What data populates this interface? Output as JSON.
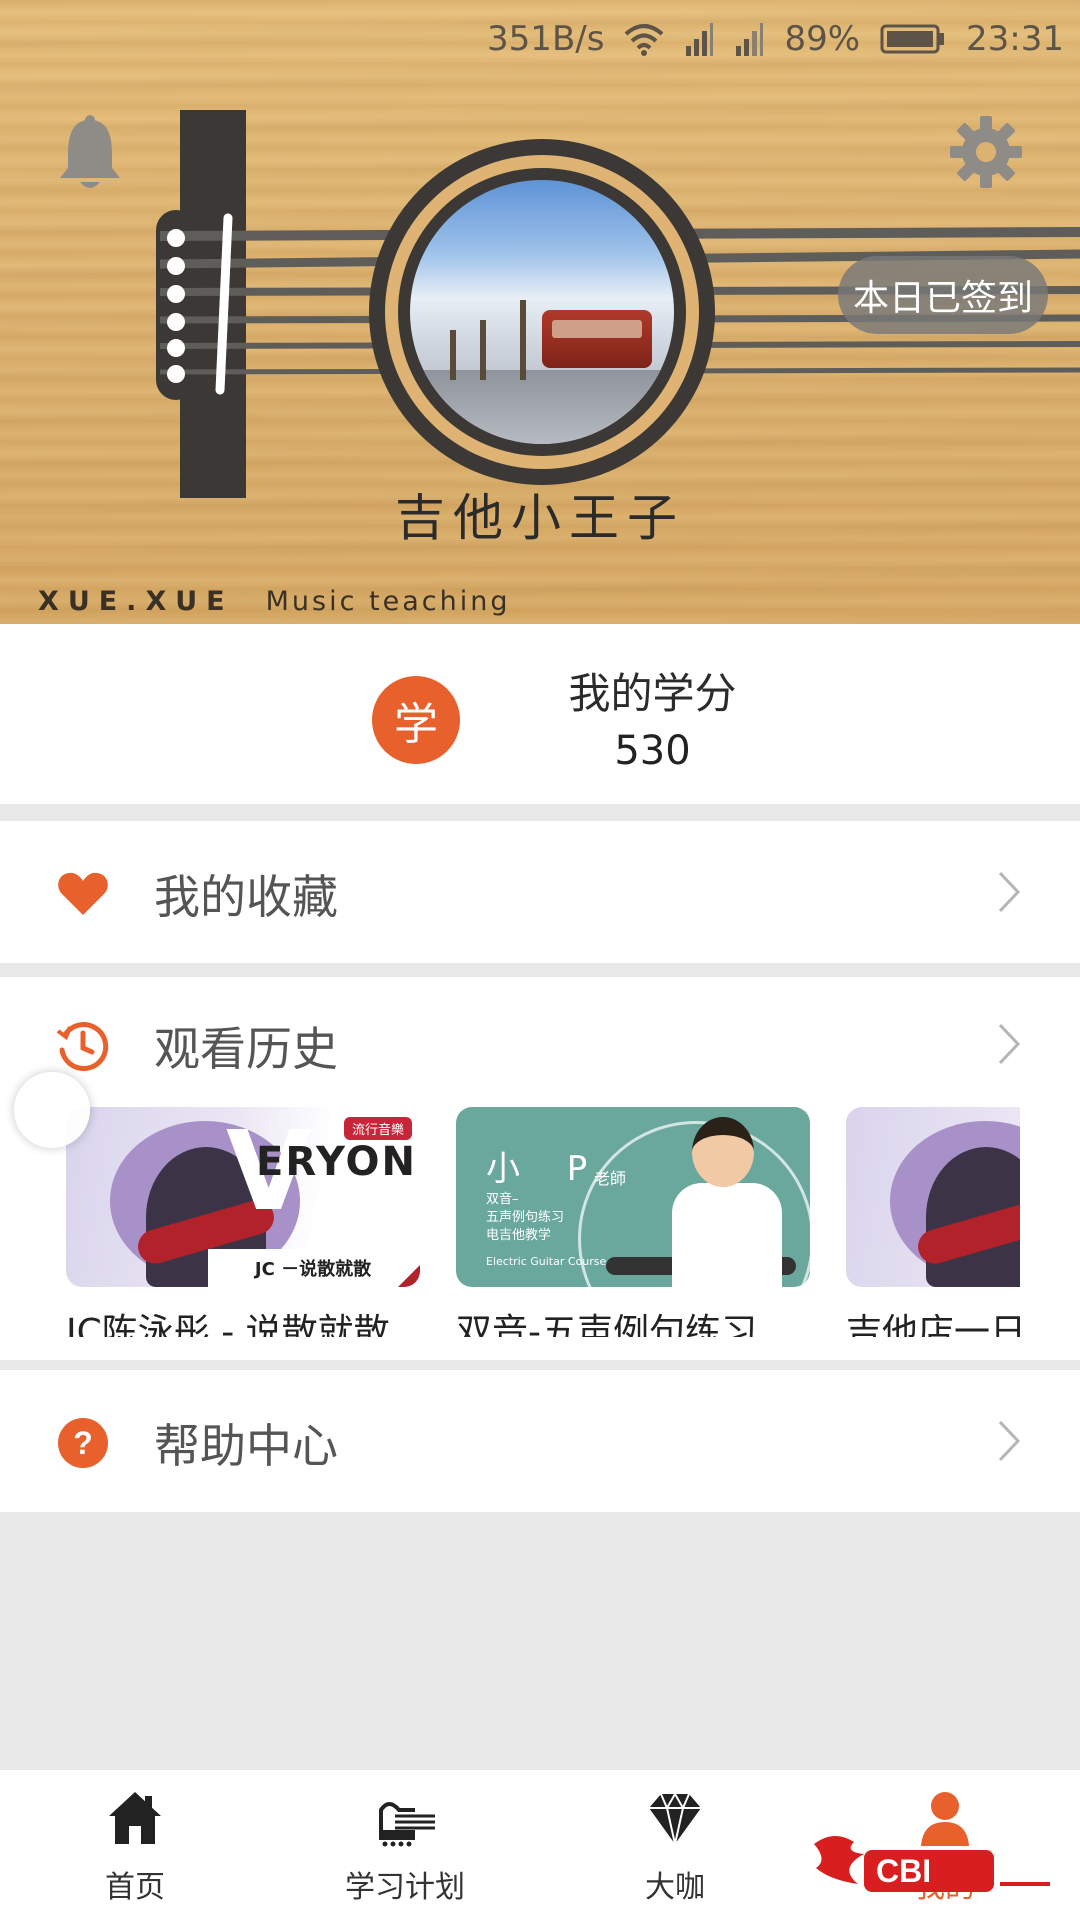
{
  "status_bar": {
    "net_speed": "351B/s",
    "battery": "89%",
    "time": "23:31",
    "icons": [
      "wifi-icon",
      "signal-icon",
      "signal-icon",
      "battery-icon"
    ]
  },
  "header": {
    "checkin_label": "本日已签到",
    "username": "吉他小王子",
    "brand": "XUE.XUE",
    "tagline": "Music   teaching",
    "icons": [
      "bell-icon",
      "gear-icon"
    ]
  },
  "credits": {
    "badge": "学",
    "label": "我的学分",
    "value": "530"
  },
  "menu": {
    "favorites": "我的收藏",
    "history": "观看历史",
    "help": "帮助中心",
    "help_icon_glyph": "?"
  },
  "history_items": [
    {
      "title": "JC陈泳彤 - 说散就散",
      "thumb_text": {
        "big": "V",
        "word": "ERYON",
        "tag": "流行音樂",
        "sub": "JC －说散就散"
      }
    },
    {
      "title": "双音-五声例句练习",
      "thumb_text": {
        "big": "小 P",
        "teacher": "老師",
        "lines": "双音–\n五声例句练习\n电吉他教学",
        "course": "Electric Guitar Course"
      }
    },
    {
      "title": "吉他店一日",
      "thumb_text": {}
    }
  ],
  "tabs": [
    {
      "label": "首页",
      "icon": "home-icon",
      "active": false
    },
    {
      "label": "学习计划",
      "icon": "guitar-plan-icon",
      "active": false
    },
    {
      "label": "大咖",
      "icon": "diamond-icon",
      "active": false
    },
    {
      "label": "我的",
      "icon": "person-icon",
      "active": true
    }
  ],
  "colors": {
    "accent": "#e8602c",
    "page_bg": "#e8e8e8",
    "wood": "#ddb270"
  }
}
